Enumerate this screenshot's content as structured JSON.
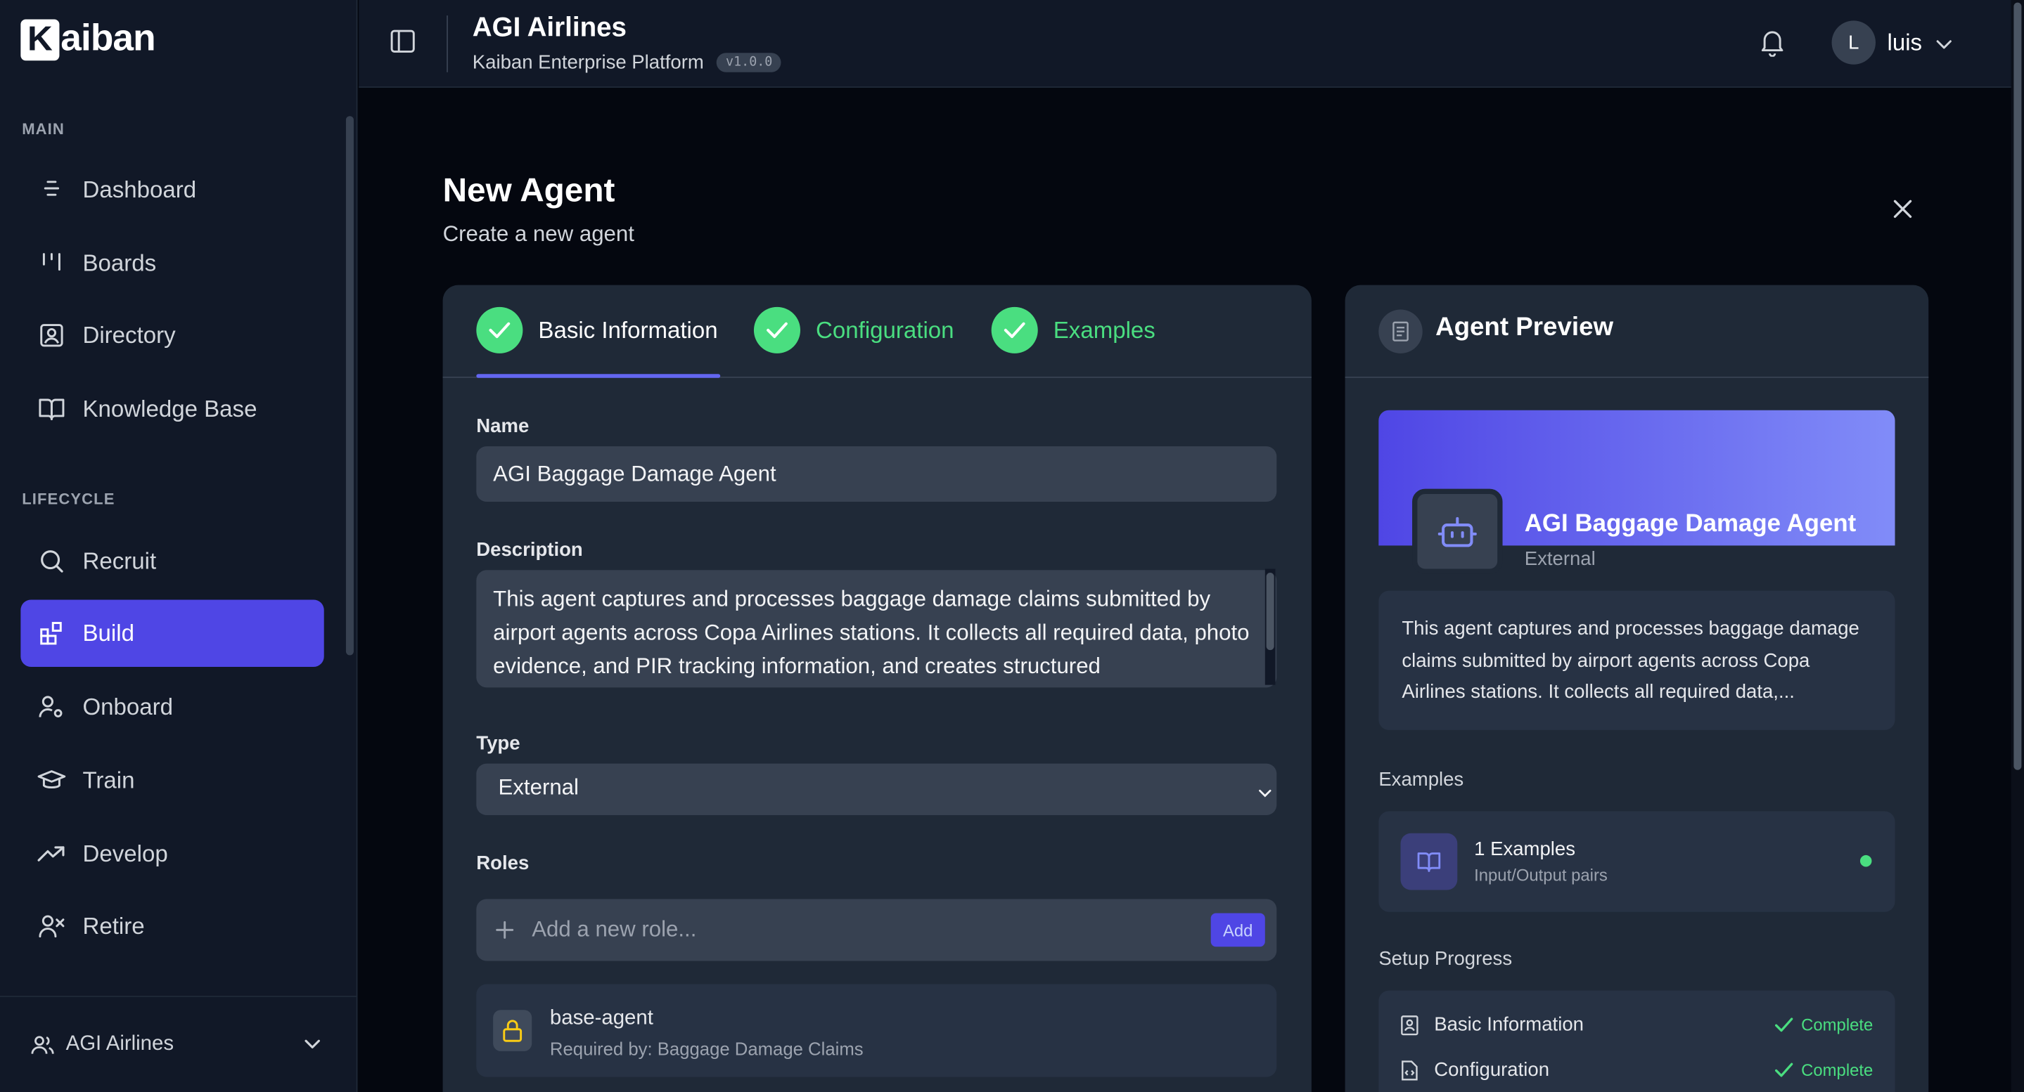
{
  "brand": {
    "logo_letter": "K",
    "logo_rest": "aiban"
  },
  "sidebar": {
    "main_label": "MAIN",
    "main_items": [
      {
        "label": "Dashboard",
        "icon": "dashboard-icon"
      },
      {
        "label": "Boards",
        "icon": "boards-icon"
      },
      {
        "label": "Directory",
        "icon": "directory-icon"
      },
      {
        "label": "Knowledge Base",
        "icon": "book-icon"
      }
    ],
    "lifecycle_label": "LIFECYCLE",
    "lifecycle_items": [
      {
        "label": "Recruit",
        "icon": "search-icon"
      },
      {
        "label": "Build",
        "icon": "build-icon",
        "active": true
      },
      {
        "label": "Onboard",
        "icon": "user-gear-icon"
      },
      {
        "label": "Train",
        "icon": "graduation-cap-icon"
      },
      {
        "label": "Develop",
        "icon": "trending-up-icon"
      },
      {
        "label": "Retire",
        "icon": "user-x-icon"
      }
    ],
    "org": "AGI Airlines"
  },
  "header": {
    "title": "AGI Airlines",
    "subtitle": "Kaiban Enterprise Platform",
    "version": "v1.0.0",
    "avatar_initial": "L",
    "username": "luis"
  },
  "page": {
    "title": "New Agent",
    "subtitle": "Create a new agent"
  },
  "steps": [
    {
      "label": "Basic Information",
      "state": "complete",
      "current": true
    },
    {
      "label": "Configuration",
      "state": "complete"
    },
    {
      "label": "Examples",
      "state": "complete"
    }
  ],
  "form": {
    "name_label": "Name",
    "name_value": "AGI Baggage Damage Agent",
    "description_label": "Description",
    "description_value": "This agent captures and processes baggage damage claims submitted by airport agents across Copa Airlines stations. It collects all required data, photo evidence, and PIR tracking information, and creates structured",
    "type_label": "Type",
    "type_value": "External",
    "roles_label": "Roles",
    "role_placeholder": "Add a new role...",
    "add_label": "Add",
    "roles": [
      {
        "name": "base-agent",
        "required_by": "Required by: Baggage Damage Claims"
      }
    ]
  },
  "preview": {
    "title": "Agent Preview",
    "agent_name": "AGI Baggage Damage Agent",
    "agent_type": "External",
    "description": "This agent captures and processes baggage damage claims submitted by airport agents across Copa Airlines stations. It collects all required data,...",
    "examples_label": "Examples",
    "examples_count": "1 Examples",
    "examples_sub": "Input/Output pairs",
    "setup_label": "Setup Progress",
    "progress": [
      {
        "label": "Basic Information",
        "status": "Complete"
      },
      {
        "label": "Configuration",
        "status": "Complete"
      }
    ]
  },
  "colors": {
    "accent": "#4f46e5",
    "success": "#4ade80",
    "background": "#04070f",
    "panel": "#111827"
  }
}
